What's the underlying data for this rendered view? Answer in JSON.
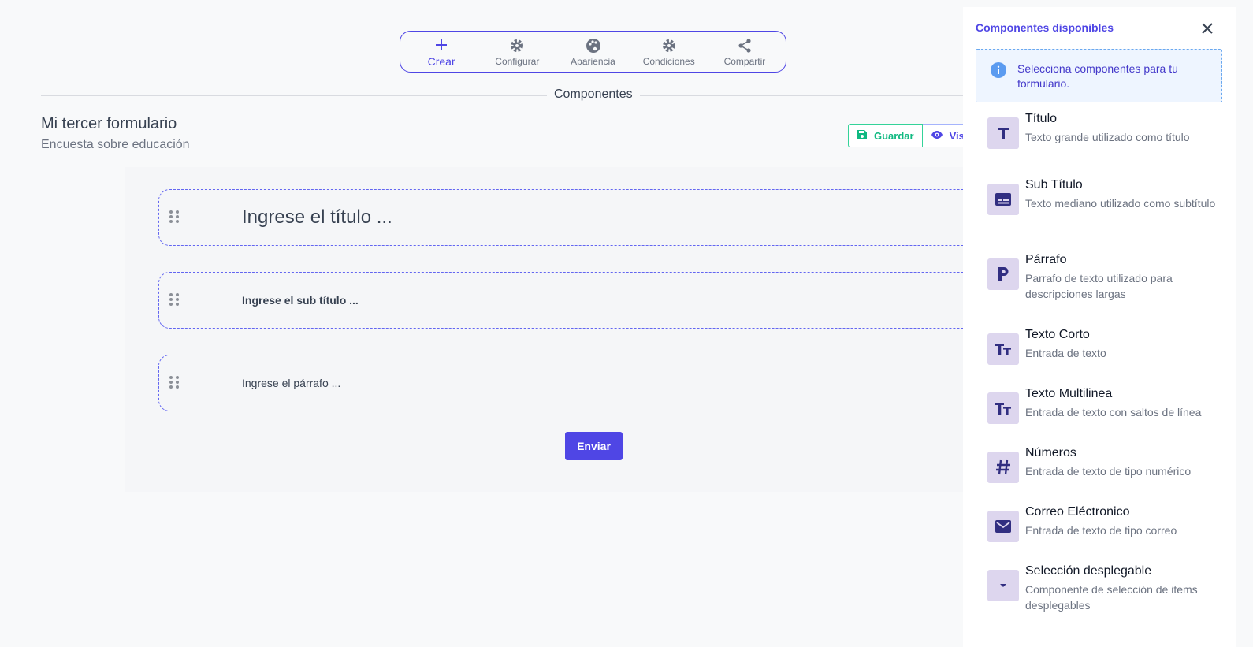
{
  "toolbar": {
    "items": [
      {
        "label": "Crear",
        "icon": "plus-icon"
      },
      {
        "label": "Configurar",
        "icon": "gear-icon"
      },
      {
        "label": "Apariencia",
        "icon": "palette-icon"
      },
      {
        "label": "Condiciones",
        "icon": "gear-icon"
      },
      {
        "label": "Compartir",
        "icon": "share-icon"
      }
    ]
  },
  "section_label": "Componentes",
  "form": {
    "title": "Mi tercer formulario",
    "subtitle": "Encuesta sobre educación",
    "save_label": "Guardar",
    "view_label": "Vist",
    "fields": [
      {
        "placeholder": "Ingrese el título ..."
      },
      {
        "placeholder": "Ingrese el sub título ..."
      },
      {
        "placeholder": "Ingrese el párrafo ..."
      }
    ],
    "submit_label": "Enviar"
  },
  "panel": {
    "title": "Componentes disponibles",
    "info": "Selecciona componentes para tu formulario.",
    "components": [
      {
        "name": "Título",
        "desc": "Texto grande utilizado como título",
        "icon": "title-icon"
      },
      {
        "name": "Sub Título",
        "desc": "Texto mediano utilizado como subtítulo",
        "icon": "subtitles-icon"
      },
      {
        "name": "Párrafo",
        "desc": "Parrafo de texto utilizado para descripciones largas",
        "icon": "paragraph-icon"
      },
      {
        "name": "Texto Corto",
        "desc": "Entrada de texto",
        "icon": "text-size-icon"
      },
      {
        "name": "Texto Multilinea",
        "desc": "Entrada de texto con saltos de línea",
        "icon": "text-size-icon"
      },
      {
        "name": "Números",
        "desc": "Entrada de texto de tipo numérico",
        "icon": "hash-icon"
      },
      {
        "name": "Correo Eléctronico",
        "desc": "Entrada de texto de tipo correo",
        "icon": "mail-icon"
      },
      {
        "name": "Selección desplegable",
        "desc": "Componente de selección de items desplegables",
        "icon": "caret-down-icon"
      }
    ]
  },
  "colors": {
    "accent": "#4f46e5",
    "save": "#10b981",
    "icon_bg": "#ddd6ee"
  }
}
